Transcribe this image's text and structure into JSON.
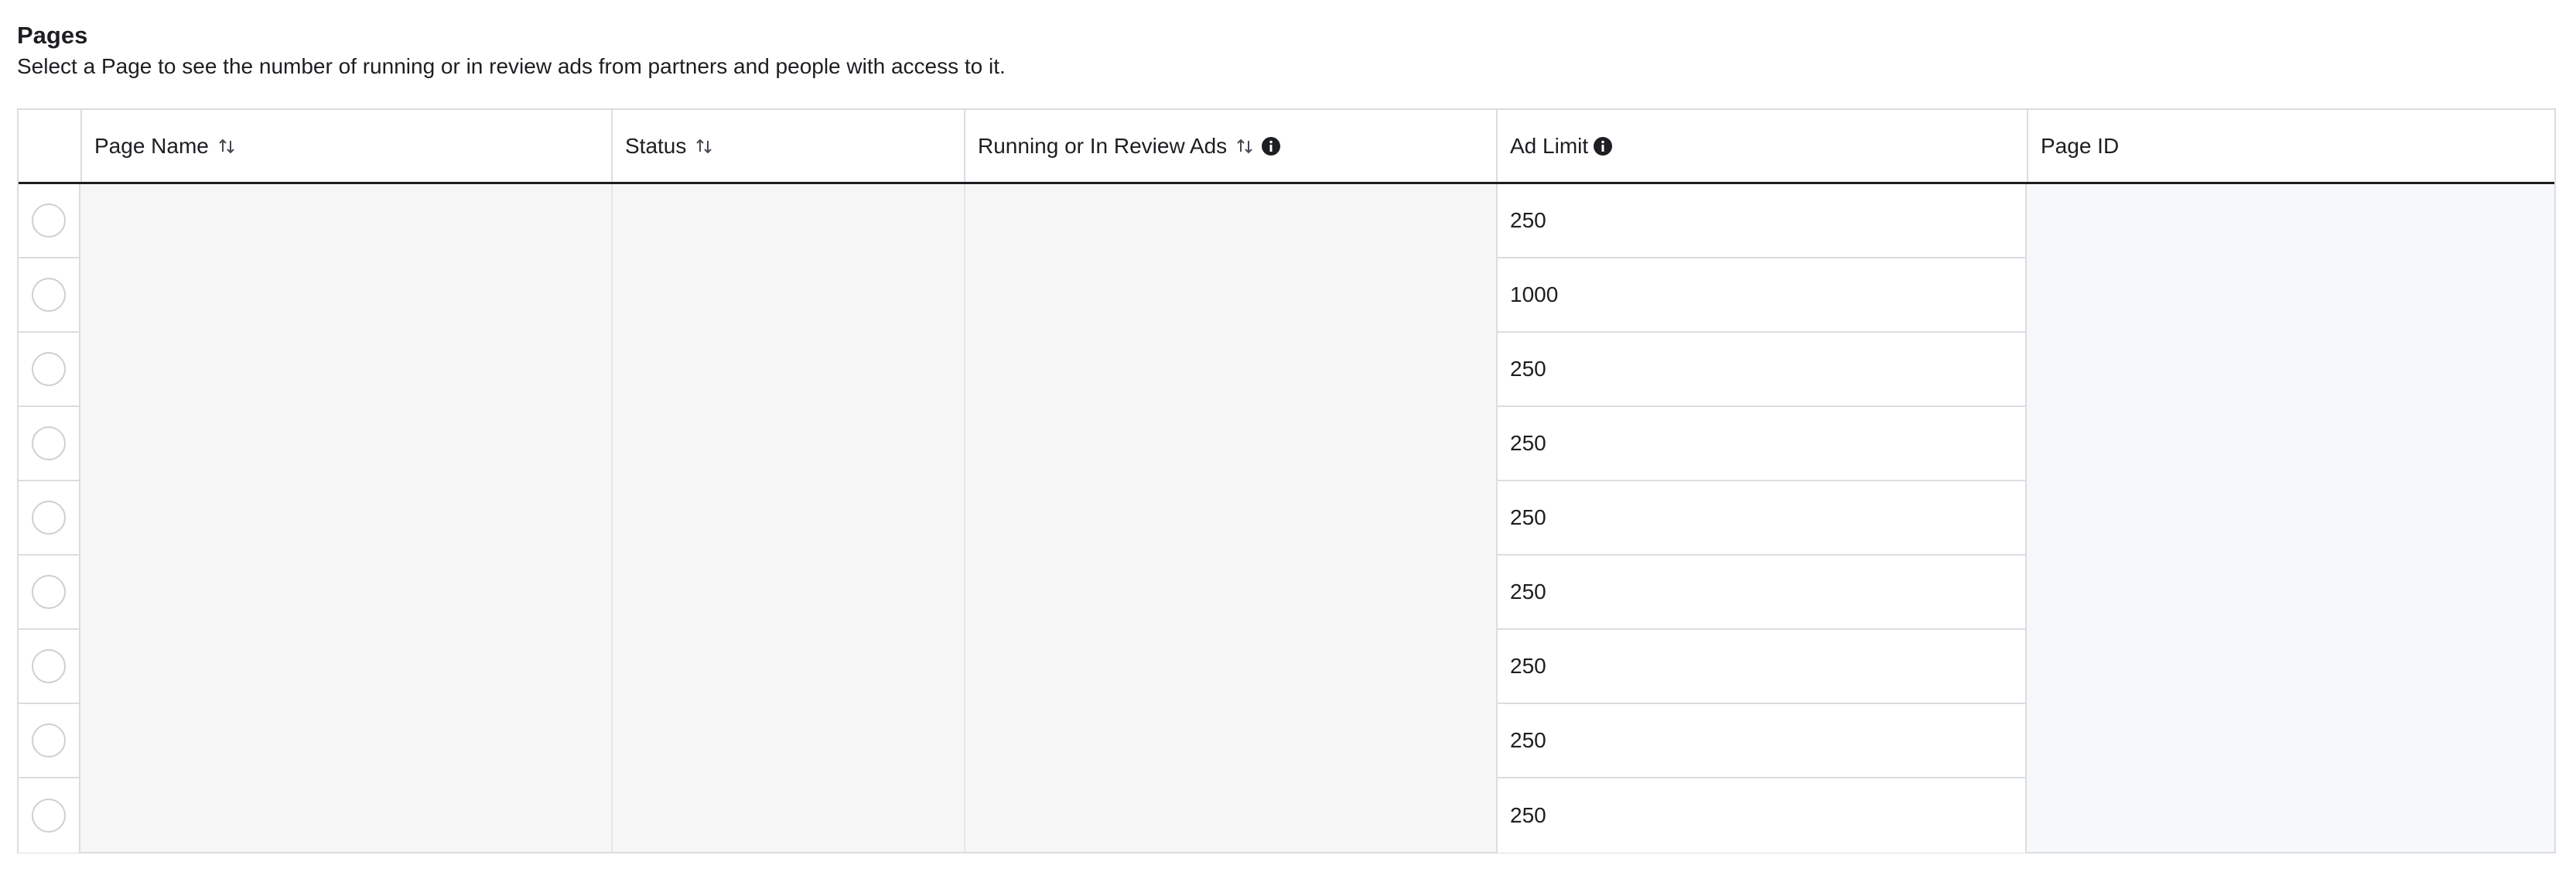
{
  "section": {
    "title": "Pages",
    "subtitle": "Select a Page to see the number of running or in review ads from partners and people with access to it."
  },
  "table": {
    "columns": [
      {
        "label": "Page Name",
        "sortable": true,
        "info": false
      },
      {
        "label": "Status",
        "sortable": true,
        "info": false
      },
      {
        "label": "Running or In Review Ads",
        "sortable": true,
        "info": true
      },
      {
        "label": "Ad Limit",
        "sortable": false,
        "info": true
      },
      {
        "label": "Page ID",
        "sortable": false,
        "info": false
      }
    ],
    "rows": [
      {
        "ad_limit": "250"
      },
      {
        "ad_limit": "1000"
      },
      {
        "ad_limit": "250"
      },
      {
        "ad_limit": "250"
      },
      {
        "ad_limit": "250"
      },
      {
        "ad_limit": "250"
      },
      {
        "ad_limit": "250"
      },
      {
        "ad_limit": "250"
      },
      {
        "ad_limit": "250"
      }
    ]
  },
  "icons": {
    "sort": "sort-arrows-icon",
    "info": "info-circle-icon",
    "radio": "radio-unselected"
  },
  "colors": {
    "text": "#1c1e21",
    "border": "#dadde1",
    "redacted": "#f6f6f6",
    "header_rule": "#1c1e21"
  }
}
